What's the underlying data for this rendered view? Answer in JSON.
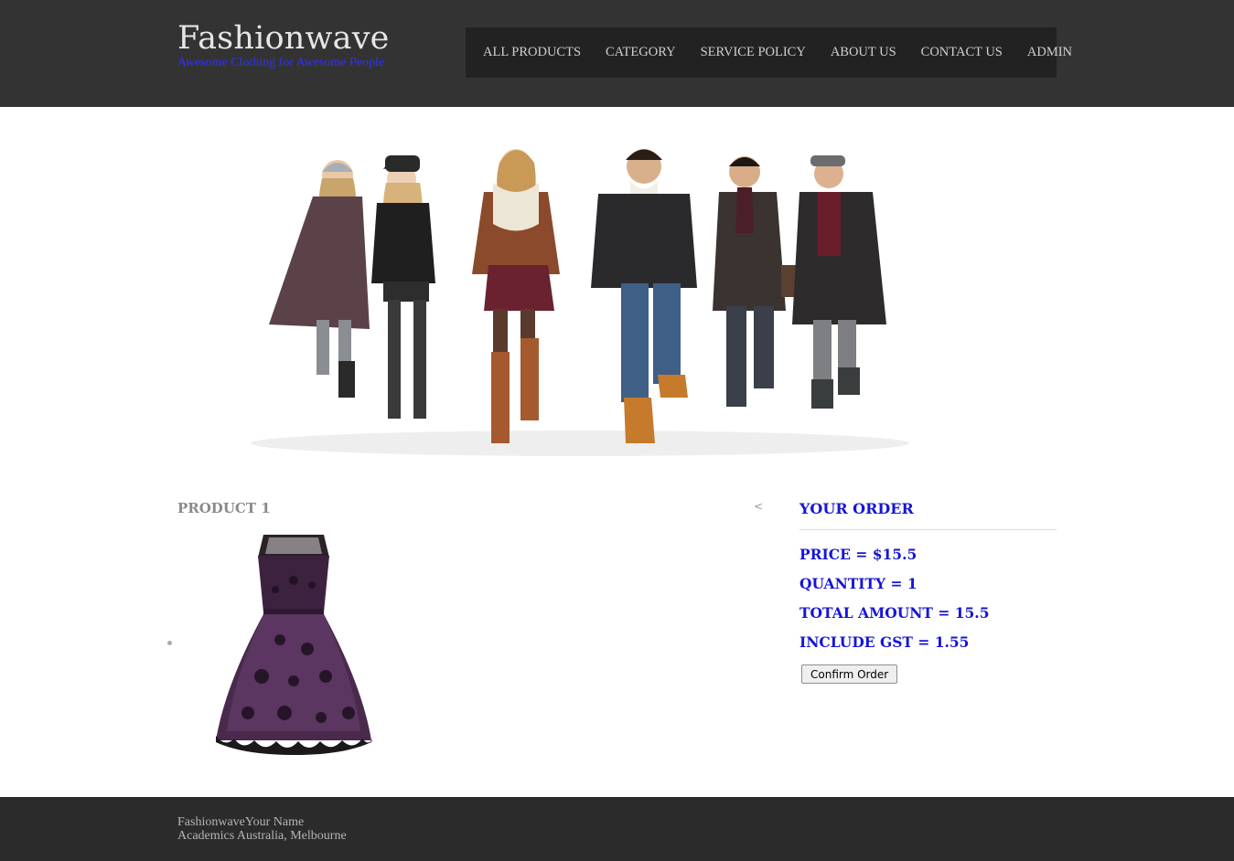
{
  "header": {
    "brand_title": "Fashionwave",
    "tagline": "Awesome Clothing for Awesome People",
    "nav": [
      {
        "label": "ALL PRODUCTS"
      },
      {
        "label": "CATEGORY"
      },
      {
        "label": "SERVICE POLICY"
      },
      {
        "label": "ABOUT US"
      },
      {
        "label": "CONTACT US"
      },
      {
        "label": "ADMIN"
      }
    ]
  },
  "hero": {
    "image": "group-of-models-in-winter-coats-illustration"
  },
  "product": {
    "heading": "PRODUCT 1",
    "prev_label": "<",
    "image": "purple-lace-dress-illustration"
  },
  "order": {
    "title": "YOUR ORDER",
    "price": "PRICE = $15.5",
    "quantity": "QUANTITY = 1",
    "total": "TOTAL AMOUNT = 15.5",
    "gst": "INCLUDE GST = 1.55",
    "confirm_label": "Confirm Order"
  },
  "footer": {
    "line1": "FashionwaveYour Name",
    "line2": "Academics Australia, Melbourne"
  },
  "colors": {
    "header_bg": "#333333",
    "nav_bg": "#222222",
    "order_text": "#1515d9",
    "tagline": "#2f31ff",
    "footer_bg": "#2b2b2b"
  }
}
